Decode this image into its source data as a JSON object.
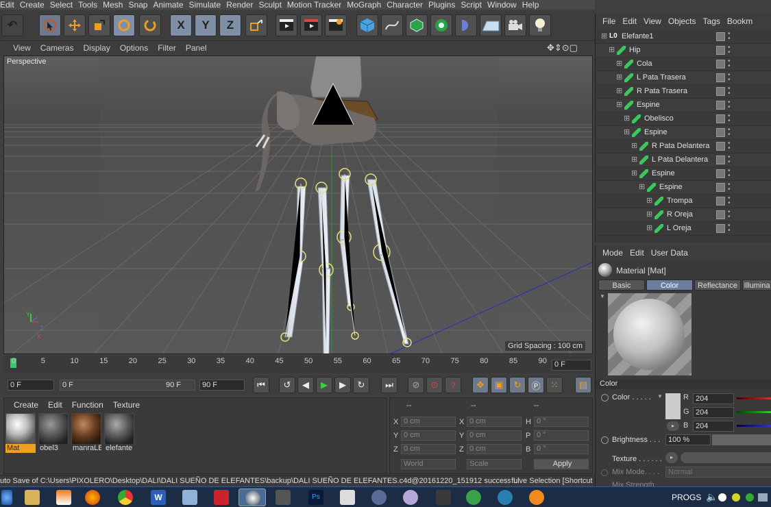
{
  "menubar": [
    "Edit",
    "Create",
    "Select",
    "Tools",
    "Mesh",
    "Snap",
    "Animate",
    "Simulate",
    "Render",
    "Sculpt",
    "Motion Tracker",
    "MoGraph",
    "Character",
    "Plugins",
    "Script",
    "Window",
    "Help"
  ],
  "toolbar": {
    "axis_x": "X",
    "axis_y": "Y",
    "axis_z": "Z"
  },
  "viewport_menu": [
    "View",
    "Cameras",
    "Display",
    "Options",
    "Filter",
    "Panel"
  ],
  "viewport": {
    "label": "Perspective",
    "grid_spacing": "Grid Spacing : 100 cm",
    "axis_y": "Y",
    "axis_z": "Z",
    "axis_x": "X"
  },
  "timeline": {
    "ticks": [
      "0",
      "5",
      "10",
      "15",
      "20",
      "25",
      "30",
      "35",
      "40",
      "45",
      "50",
      "55",
      "60",
      "65",
      "70",
      "75",
      "80",
      "85",
      "90"
    ],
    "current_frame": "0 F"
  },
  "transport": {
    "start": "0 F",
    "slider_start": "0 F",
    "slider_end": "90 F",
    "end": "90 F"
  },
  "material_manager": {
    "menu": [
      "Create",
      "Edit",
      "Function",
      "Texture"
    ],
    "materials": [
      {
        "name": "Mat"
      },
      {
        "name": "obel3"
      },
      {
        "name": "manraLE"
      },
      {
        "name": "elefante"
      }
    ]
  },
  "coordinates": {
    "headers": [
      "--",
      "--",
      "--"
    ],
    "rows": [
      {
        "a": "X",
        "av": "0 cm",
        "b": "X",
        "bv": "0 cm",
        "c": "H",
        "cv": "0 °"
      },
      {
        "a": "Y",
        "av": "0 cm",
        "b": "Y",
        "bv": "0 cm",
        "c": "P",
        "cv": "0 °"
      },
      {
        "a": "Z",
        "av": "0 cm",
        "b": "Z",
        "bv": "0 cm",
        "c": "B",
        "cv": "0 °"
      }
    ],
    "mode_world": "World",
    "mode_scale": "Scale",
    "apply": "Apply"
  },
  "status": {
    "left": "uto Save of C:\\Users\\PIXOLERO\\Desktop\\DALI\\DALI SUEÑO DE ELEFANTES\\backup\\DALI SUEÑO DE ELEFANTES.c4d@20161220_151912 successful",
    "right": "Live Selection [Shortcut"
  },
  "object_manager": {
    "menu": [
      "File",
      "Edit",
      "View",
      "Objects",
      "Tags",
      "Bookm"
    ],
    "objects": [
      {
        "name": "Elefante1",
        "depth": 0,
        "type": "null"
      },
      {
        "name": "Hip",
        "depth": 1,
        "type": "joint"
      },
      {
        "name": "Cola",
        "depth": 2,
        "type": "joint"
      },
      {
        "name": "L Pata Trasera",
        "depth": 2,
        "type": "joint"
      },
      {
        "name": "R Pata Trasera",
        "depth": 2,
        "type": "joint"
      },
      {
        "name": "Espine",
        "depth": 2,
        "type": "joint"
      },
      {
        "name": "Obelisco",
        "depth": 3,
        "type": "joint"
      },
      {
        "name": "Espine",
        "depth": 3,
        "type": "joint"
      },
      {
        "name": "R Pata Delantera",
        "depth": 4,
        "type": "joint"
      },
      {
        "name": "L Pata Delantera",
        "depth": 4,
        "type": "joint"
      },
      {
        "name": "Espine",
        "depth": 4,
        "type": "joint"
      },
      {
        "name": "Espine",
        "depth": 5,
        "type": "joint"
      },
      {
        "name": "Trompa",
        "depth": 6,
        "type": "joint"
      },
      {
        "name": "R Oreja",
        "depth": 6,
        "type": "joint"
      },
      {
        "name": "L Oreja",
        "depth": 6,
        "type": "joint"
      }
    ]
  },
  "attributes": {
    "menu": [
      "Mode",
      "Edit",
      "User Data"
    ],
    "title": "Material [Mat]",
    "tabs": [
      "Basic",
      "Color",
      "Reflectance",
      "Illumina"
    ],
    "selected_tab": "Color",
    "section": "Color",
    "color_label": "Color . . . . .",
    "r_label": "R",
    "r": "204",
    "g_label": "G",
    "g": "204",
    "b_label": "B",
    "b": "204",
    "brightness_label": "Brightness . . .",
    "brightness": "100 %",
    "texture_label": "Texture . . . . . .",
    "mixmode_label": "Mix Mode. . . .",
    "mixmode": "Normal",
    "mixstrength_label": "Mix Strength"
  },
  "taskbar": {
    "progs": "PROGS"
  },
  "colors": {
    "accent": "#6a7fa0",
    "panel": "#3a3a3a",
    "viewport_bg": "#4f4f4f"
  }
}
